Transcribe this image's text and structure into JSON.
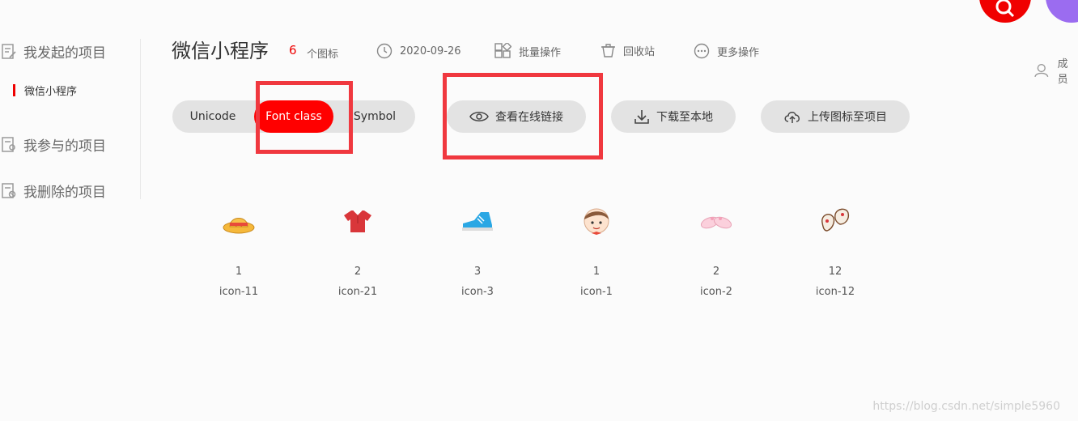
{
  "sidebar": {
    "items": [
      {
        "label": "我发起的项目"
      },
      {
        "label": "我参与的项目"
      },
      {
        "label": "我删除的项目"
      }
    ],
    "active_project": "微信小程序"
  },
  "header": {
    "title": "微信小程序",
    "icon_count": "6",
    "icon_count_unit": "个图标",
    "date": "2020-09-26",
    "batch_label": "批量操作",
    "recycle_label": "回收站",
    "more_label": "更多操作",
    "members_label": "成员"
  },
  "toolbar": {
    "tabs": [
      "Unicode",
      "Font class",
      "Symbol"
    ],
    "active_tab": "Font class",
    "view_link_label": "查看在线链接",
    "download_label": "下载至本地",
    "upload_label": "上传图标至项目"
  },
  "icons": [
    {
      "code": "1",
      "name": "icon-11",
      "glyph": "hat-icon"
    },
    {
      "code": "2",
      "name": "icon-21",
      "glyph": "shirt-icon"
    },
    {
      "code": "3",
      "name": "icon-3",
      "glyph": "sneaker-icon"
    },
    {
      "code": "1",
      "name": "icon-1",
      "glyph": "boy-face-icon"
    },
    {
      "code": "2",
      "name": "icon-2",
      "glyph": "slippers-icon"
    },
    {
      "code": "12",
      "name": "icon-12",
      "glyph": "mittens-icon"
    }
  ],
  "colors": {
    "accent": "#f00000",
    "highlight_box": "#f0383f",
    "purple": "#9b6cf0"
  },
  "watermark": "https://blog.csdn.net/simple5960"
}
